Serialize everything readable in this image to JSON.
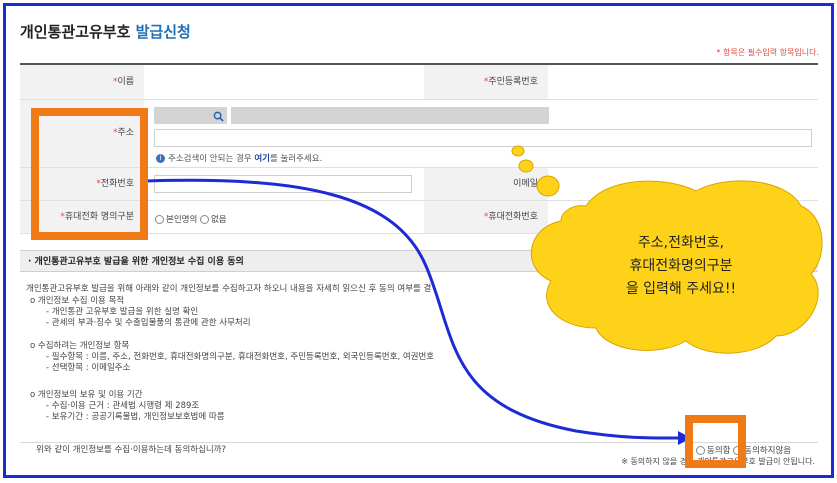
{
  "header": {
    "title_main": "개인통관고유부호",
    "title_accent": "발급신청",
    "required_note": "* 항목은 필수입력 항목입니다."
  },
  "form": {
    "name_label": "이름",
    "rrn_label": "주민등록번호",
    "address_label": "주소",
    "address_hint_prefix": "주소검색이 안되는 경우",
    "address_hint_link": "여기",
    "address_hint_suffix": "를 눌러주세요.",
    "phone_label": "전화번호",
    "email_label": "이메일",
    "mobile_type_label": "휴대전화 명의구분",
    "mobile_type_options": [
      "본인명의",
      "없음"
    ],
    "mobile_label": "휴대전화번호",
    "required_mark": "*"
  },
  "consent": {
    "section_title": "· 개인통관고유부호 발급을 위한 개인정보 수집 이용 동의",
    "intro": "개인통관고유부호 발급을 위해 아래와 같이 개인정보를 수집하고자 하오니 내용을 자세히 읽으신 후 동의 여부를 결",
    "purpose_title": "o 개인정보 수집 이용 목적",
    "purpose_items": [
      "- 개인통관 고유부호 발급을 위한 실명 확인",
      "- 관세의 부과·징수 및 수출입물품의 통관에 관한 사무처리"
    ],
    "items_title": "o 수집하려는 개인정보 항목",
    "items_required": "- 필수항목 : 이름, 주소, 전화번호, 휴대전화명의구분, 휴대전화번호, 주민등록번호, 외국인등록번호, 여권번호",
    "items_optional": "- 선택항목 : 이메일주소",
    "retention_title": "o 개인정보의 보유 및 이용 기간",
    "retention_basis": "- 수집·이용 근거 : 관세법 시행령 제 289조",
    "retention_period": "- 보유기간 : 공공기록물법, 개인정보보호법에 따름",
    "question": "위와 같이 개인정보를 수집·이용하는데 동의하십니까?",
    "agree_label": "동의함",
    "disagree_label": "동의하지않음",
    "footnote": "※ 동의하지 않을 경우 개인통관고유부호 발급이 안됩니다."
  },
  "callout": {
    "lines": [
      "주소,전화번호,",
      "휴대전화명의구분",
      "을  입력해  주세요!!"
    ]
  },
  "colors": {
    "frame": "#1d2bd6",
    "highlight": "#f07b16",
    "bubble": "#ffd21a",
    "arrow": "#1d2bd6",
    "accent": "#1f6fb8",
    "required": "#e0463f"
  }
}
